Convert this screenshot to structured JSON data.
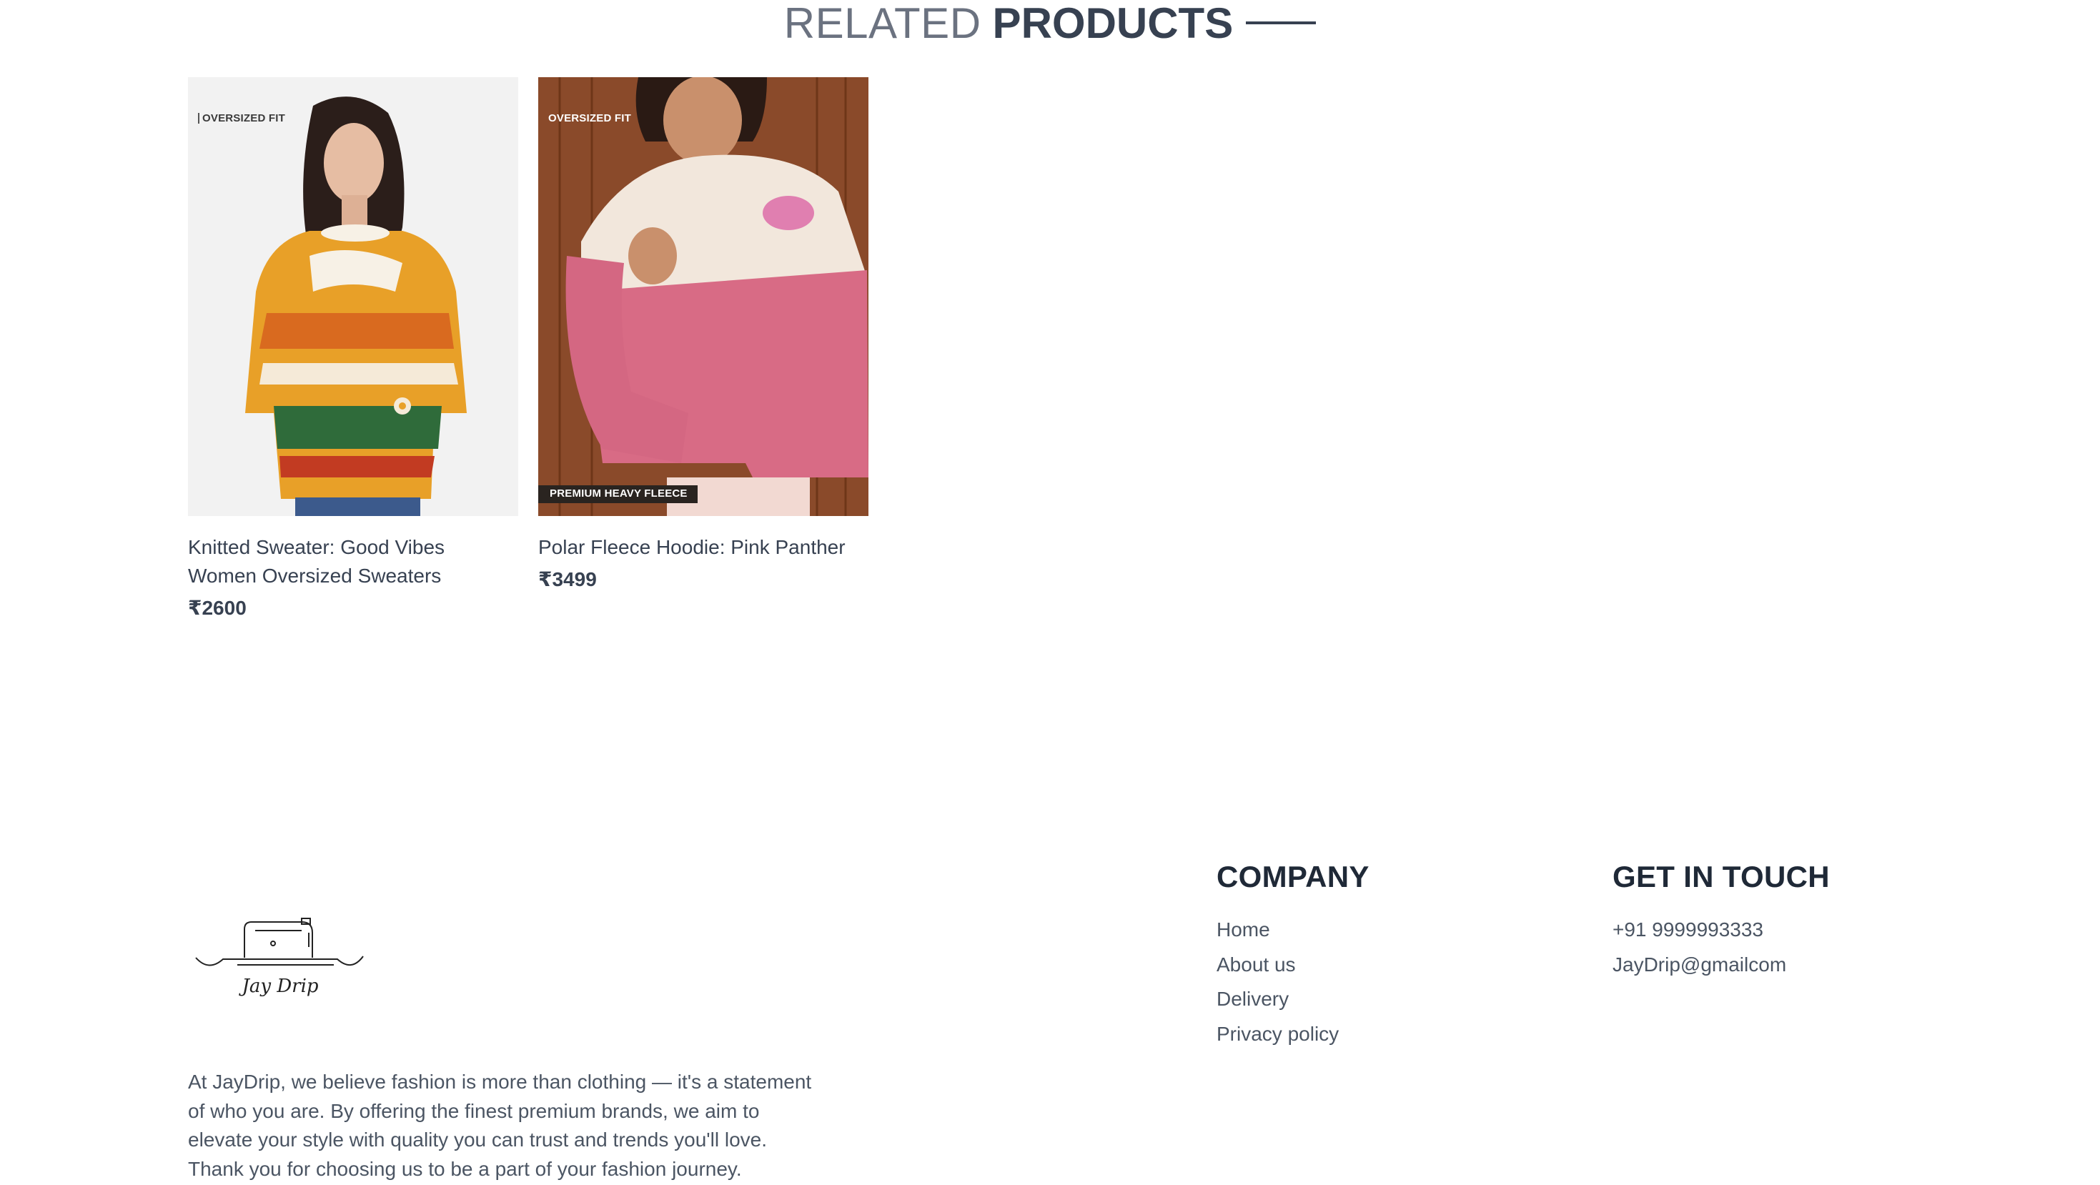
{
  "related": {
    "title_light": "RELATED",
    "title_bold": "PRODUCTS"
  },
  "products": [
    {
      "badge_top": "OVERSIZED FIT",
      "badge_bottom": "",
      "name": "Knitted Sweater: Good Vibes Women Oversized Sweaters",
      "price": "₹2600"
    },
    {
      "badge_top": "OVERSIZED FIT",
      "badge_bottom": "PREMIUM HEAVY FLEECE",
      "name": "Polar Fleece Hoodie: Pink Panther",
      "price": "₹3499"
    }
  ],
  "footer": {
    "logo_text": "Jay Drip",
    "about": "At JayDrip, we believe fashion is more than clothing — it's a statement of who you are. By offering the finest premium brands, we aim to elevate your style with quality you can trust and trends you'll love. Thank you for choosing us to be a part of your fashion journey.",
    "company": {
      "heading": "COMPANY",
      "links": [
        "Home",
        "About us",
        "Delivery",
        "Privacy policy"
      ]
    },
    "contact": {
      "heading": "GET IN TOUCH",
      "phone": "+91 9999993333",
      "email": "JayDrip@gmailcom"
    }
  },
  "icons": {
    "logo": "sewing-machine-icon"
  },
  "colors": {
    "text_dark": "#374151",
    "text_muted": "#6b7280",
    "heading": "#1f2937"
  }
}
